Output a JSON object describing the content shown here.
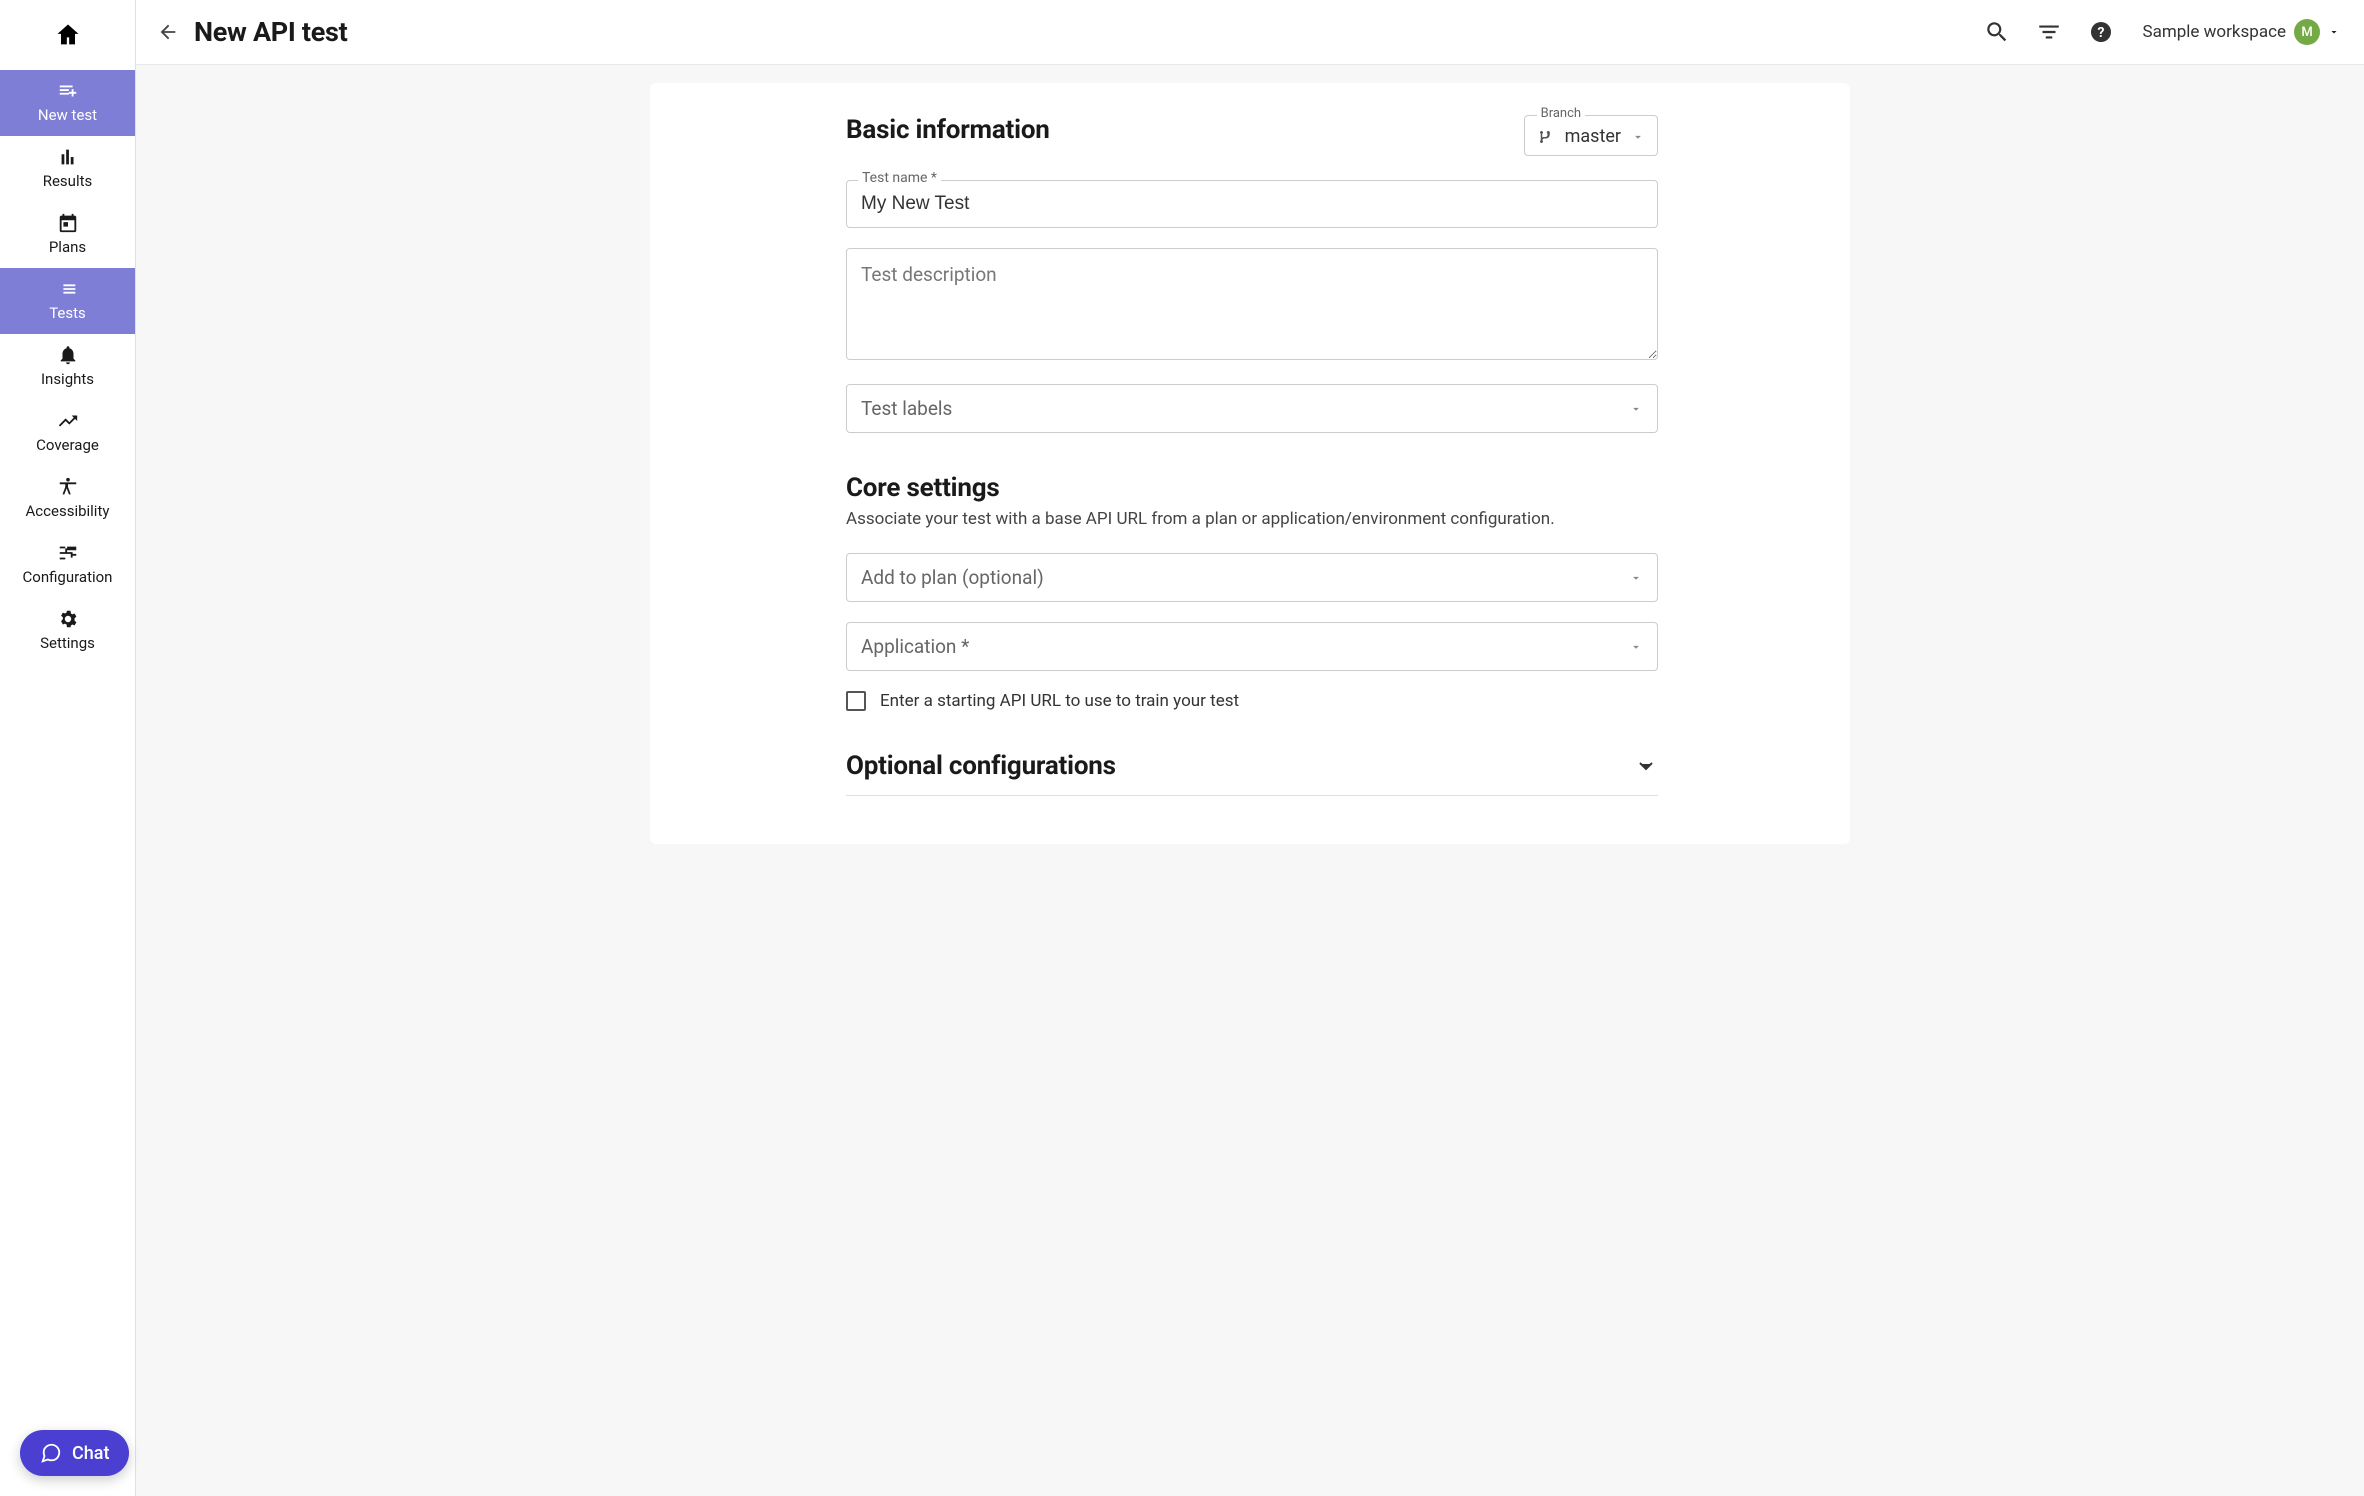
{
  "sidebar": {
    "items": [
      {
        "label": "New test"
      },
      {
        "label": "Results"
      },
      {
        "label": "Plans"
      },
      {
        "label": "Tests"
      },
      {
        "label": "Insights"
      },
      {
        "label": "Coverage"
      },
      {
        "label": "Accessibility"
      },
      {
        "label": "Configuration"
      },
      {
        "label": "Settings"
      }
    ]
  },
  "header": {
    "title": "New API test",
    "workspace": "Sample workspace",
    "avatar_initial": "M"
  },
  "form": {
    "basic": {
      "title": "Basic information",
      "branch_label": "Branch",
      "branch_value": "master",
      "test_name_label": "Test name *",
      "test_name_value": "My New Test",
      "description_placeholder": "Test description",
      "labels_placeholder": "Test labels"
    },
    "core": {
      "title": "Core settings",
      "subtitle": "Associate your test with a base API URL from a plan or application/environment configuration.",
      "plan_placeholder": "Add to plan (optional)",
      "application_placeholder": "Application *",
      "checkbox_label": "Enter a starting API URL to use to train your test"
    },
    "optional": {
      "title": "Optional configurations"
    }
  },
  "chat": {
    "label": "Chat"
  }
}
